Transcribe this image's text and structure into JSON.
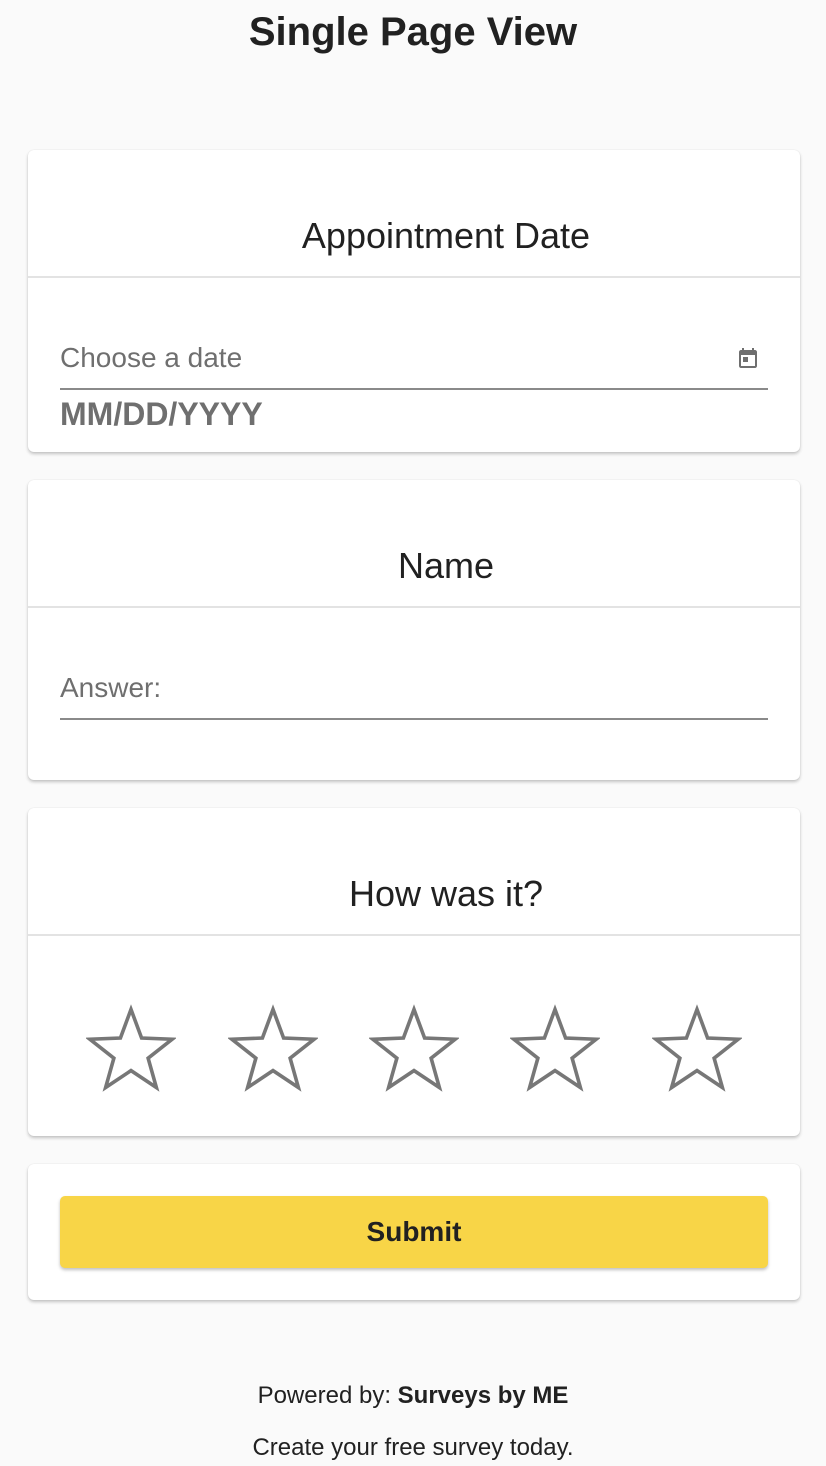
{
  "page": {
    "title": "Single Page View"
  },
  "questions": {
    "appointment_date": {
      "title": "Appointment Date",
      "placeholder": "Choose a date",
      "format_hint": "MM/DD/YYYY",
      "icon": "calendar-icon"
    },
    "name": {
      "title": "Name",
      "placeholder": "Answer:"
    },
    "rating": {
      "title": "How was it?",
      "max_stars": 5,
      "selected": 0,
      "icon": "star-outline-icon"
    }
  },
  "submit": {
    "label": "Submit",
    "color": "#f8d547"
  },
  "footer": {
    "powered_prefix": "Powered by:",
    "brand": "Surveys by ME",
    "tagline": "Create your free survey today."
  },
  "colors": {
    "background": "#fafafa",
    "card": "#ffffff",
    "muted_text": "#6f6f6f",
    "star_outline": "#777777"
  }
}
